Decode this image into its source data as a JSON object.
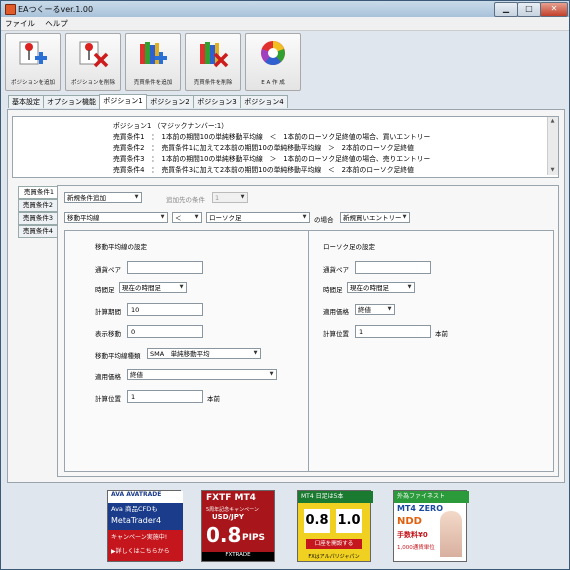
{
  "window": {
    "title": "EAつくーるver.1.00",
    "min_label": "▁",
    "max_label": "□",
    "close_label": "✕"
  },
  "menu": [
    "ファイル",
    "ヘルプ"
  ],
  "toolbar": [
    {
      "label": "ポジションを追加"
    },
    {
      "label": "ポジションを削除"
    },
    {
      "label": "売買条件を追加"
    },
    {
      "label": "売買条件を削除"
    },
    {
      "label": "E A 作 成"
    }
  ],
  "tabs": [
    "基本設定",
    "オプション機能",
    "ポジション1",
    "ポジション2",
    "ポジション3",
    "ポジション4"
  ],
  "summary_lines": [
    "ポジション1 （マジックナンバー:1）",
    "売買条件1　：　1本前の期間10の単純移動平均線　＜　1本前のローソク足終値の場合、買いエントリー",
    "売買条件2　：　売買条件1に加えて2本前の期間10の単純移動平均線　＞　2本前のローソク足終値",
    "売買条件3　：　1本前の期間10の単純移動平均線　＞　1本前のローソク足終値の場合、売りエントリー",
    "売買条件4　：　売買条件3に加えて2本前の期間10の単純移動平均線　＜　2本前のローソク足終値"
  ],
  "side_tabs": [
    "売買条件1",
    "売買条件2",
    "売買条件3",
    "売買条件4"
  ],
  "cond": {
    "type_value": "新規条件追加",
    "target_label": "追加先の条件",
    "target_value": "1",
    "left_value": "移動平均線",
    "op_value": "＜",
    "right_value": "ローソク足",
    "case_label": "の場合",
    "action_value": "新規買いエントリー"
  },
  "left_panel": {
    "title": "移動平均線の設定",
    "pair_label": "通貨ペア",
    "pair_value": "",
    "timeframe_label": "時間足",
    "timeframe_value": "現在の時間足",
    "period_label": "計算期間",
    "period_value": "10",
    "shift_label": "表示移動",
    "shift_value": "0",
    "ma_type_label": "移動平均線種類",
    "ma_type_value": "SMA　単純移動平均",
    "price_label": "適用価格",
    "price_value": "終値",
    "pos_label": "計算位置",
    "pos_value": "1",
    "pos_unit": "本前"
  },
  "right_panel": {
    "title": "ローソク足の設定",
    "pair_label": "通貨ペア",
    "pair_value": "",
    "timeframe_label": "時間足",
    "timeframe_value": "現在の時間足",
    "price_label": "適用価格",
    "price_value": "終値",
    "pos_label": "計算位置",
    "pos_value": "1",
    "pos_unit": "本前"
  },
  "ads": [
    {
      "line1": "AVA AVATRADE",
      "line2": "Ava 商品CFDも",
      "line3": "MetaTrader4",
      "line4": "キャンペーン実施中!",
      "line5": "▶詳しくはこちらから"
    },
    {
      "line1": "FXTF MT4",
      "line2": "5周年記念キャンペーン",
      "line3": "USD/JPY",
      "line4": "0.8",
      "line5": "PIPS",
      "line6": "FXTRADE"
    },
    {
      "line1": "MT4 日足は5本",
      "line2": "0.8",
      "line3": "1.0",
      "line4": "口座を開設する",
      "line5": "FXはアルパリジャパン"
    },
    {
      "line1": "外為ファイネスト",
      "line2": "MT4 ZERO",
      "line3": "NDD",
      "line4": "手数料¥0",
      "line5": "1,000通貨単位"
    }
  ],
  "colors": {
    "title_bar": "#b8cde0",
    "panel": "#f5f5f5",
    "accent_red": "#cc1c1c"
  }
}
